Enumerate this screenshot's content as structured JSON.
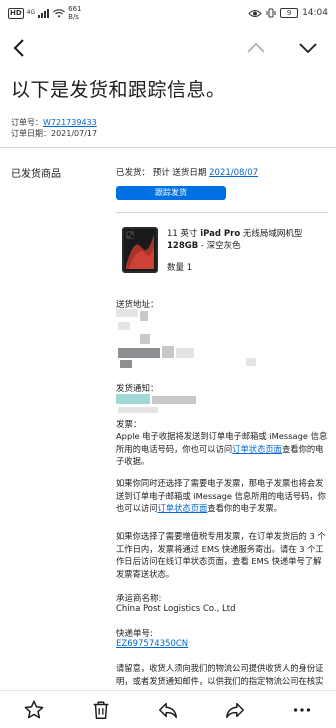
{
  "status_bar": {
    "hd": "HD",
    "signal": "4G",
    "speed_value": "661",
    "speed_unit": "B/s",
    "battery": "9",
    "time": "14:04"
  },
  "header": {
    "title": "以下是发货和跟踪信息。"
  },
  "order": {
    "number_label": "订单号：",
    "number": "W721739433",
    "date_label": "订单日期：",
    "date": "2021/07/17"
  },
  "shipped": {
    "section_label": "已发货商品",
    "status_label": "已发货",
    "eta_label": "预计 送货日期",
    "eta_date": "2021/08/07",
    "track_button": "跟踪发货"
  },
  "product": {
    "name_prefix": "11 英寸 ",
    "name_bold": "iPad Pro",
    "name_mid": " 无线局域网机型 ",
    "name_capacity": "128GB",
    "name_suffix": " - 深空灰色",
    "quantity": "数量 1"
  },
  "delivery": {
    "address_label": "送货地址：",
    "notify_label": "发货通知："
  },
  "invoice": {
    "label": "发票：",
    "p1_a": "Apple 电子收据将发送到订单电子邮箱或 iMessage 信息所用的电话号码，你也可以访问",
    "p1_link": "订单状态页面",
    "p1_b": "查看你的电子收据。",
    "p2_a": "如果你同时还选择了需要电子发票，那电子发票也将会发送到订单电子邮箱或 iMessage 信息所用的电话号码，你也可以访问",
    "p2_link": "订单状态页面",
    "p2_b": "查看你的电子发票。",
    "p3": "如果你选择了需要增值税专用发票，在订单发货后的 3 个工作日内，发票将通过 EMS 快递服务寄出。请在 3 个工作日后访问在线订单状态页面，查看 EMS 快递单号了解发票寄送状态。"
  },
  "carrier": {
    "label": "承运商名称:",
    "name": "China Post Logistics Co., Ltd",
    "tracking_label": "快递单号:",
    "tracking_number": "EZ697574350CN",
    "notice": "请留意，收货人须向我们的物流公司提供收货人的身份证明，或者发货通知邮件，以供我们的指定物流公司在核实"
  },
  "toolbar": {
    "icons": [
      "star-icon",
      "trash-icon",
      "reply-icon",
      "forward-icon",
      "more-icon"
    ]
  }
}
